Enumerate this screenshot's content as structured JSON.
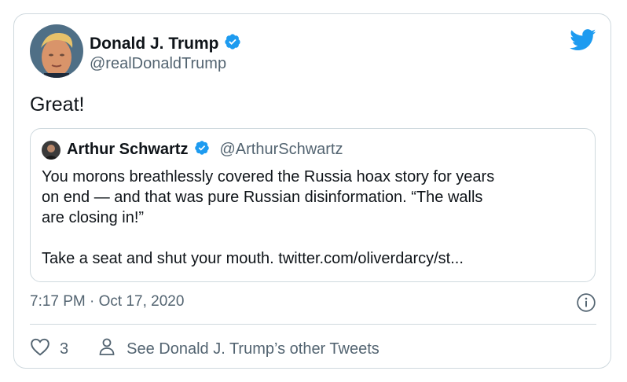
{
  "author": {
    "name": "Donald J. Trump",
    "handle": "@realDonaldTrump",
    "verified": true
  },
  "tweet_text": "Great!",
  "quoted": {
    "name": "Arthur Schwartz",
    "handle": "@ArthurSchwartz",
    "verified": true,
    "line1": "You morons breathlessly covered the Russia hoax story for years",
    "line2": "on end — and that was pure Russian disinformation. “The walls",
    "line3": "are closing in!”",
    "line4": "Take a seat and shut your mouth. twitter.com/oliverdarcy/st..."
  },
  "timestamp": "7:17 PM · Oct 17, 2020",
  "likes": "3",
  "other_tweets_label": "See Donald J. Trump’s other Tweets",
  "colors": {
    "verified_blue": "#1d9bf0",
    "twitter_blue": "#1d9bf0",
    "secondary_text": "#536471",
    "border": "#cfd9de"
  },
  "icons": [
    "twitter-bird-icon",
    "verified-badge-icon",
    "info-icon",
    "heart-icon",
    "person-icon"
  ]
}
